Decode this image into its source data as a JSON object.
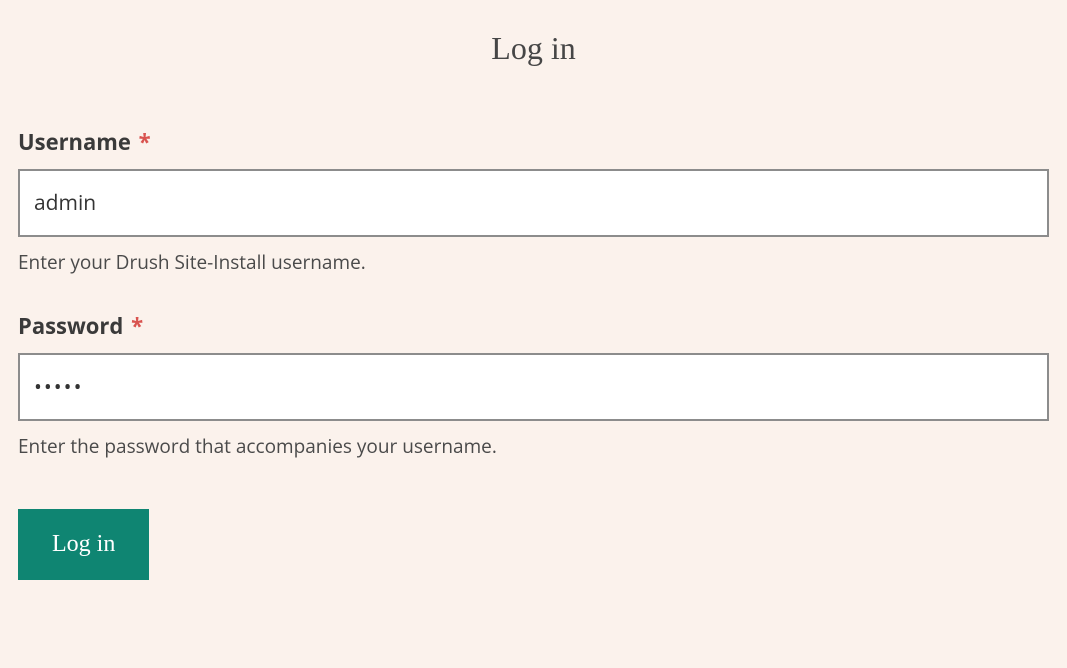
{
  "page": {
    "title": "Log in"
  },
  "form": {
    "username": {
      "label": "Username",
      "required_marker": "*",
      "value": "admin",
      "help": "Enter your Drush Site-Install username."
    },
    "password": {
      "label": "Password",
      "required_marker": "*",
      "value": "•••••",
      "help": "Enter the password that accompanies your username."
    },
    "submit": {
      "label": "Log in"
    }
  }
}
